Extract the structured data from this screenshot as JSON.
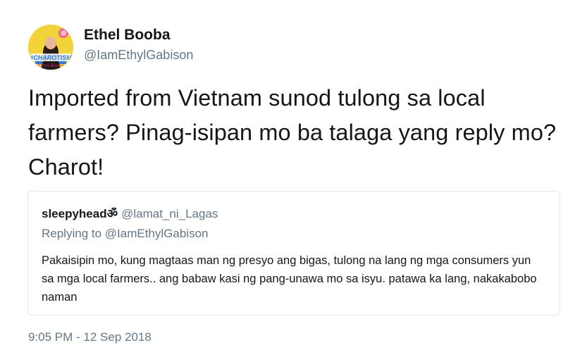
{
  "author": {
    "display_name": "Ethel Booba",
    "handle": "@IamEthylGabison",
    "avatar_text": "#CHAROTISM",
    "avatar_signature": "Ethel Booba",
    "avatar_icon": "profile-avatar"
  },
  "tweet": {
    "text": "Imported from Vietnam sunod tulong sa local farmers? Pinag-isipan mo ba talaga yang reply mo? Charot!",
    "timestamp": "9:05 PM - 12 Sep 2018"
  },
  "quoted_tweet": {
    "display_name": "sleepyheadॐ",
    "handle": "@lamat_ni_Lagas",
    "replying_to": "Replying to @IamEthylGabison",
    "text": "Pakaisipin mo, kung magtaas man ng presyo ang bigas, tulong na lang ng mga consumers yun sa mga local farmers.. ang babaw kasi ng pang-unawa mo sa isyu. patawa ka lang, nakakabobo naman"
  },
  "colors": {
    "primary_text": "#14171a",
    "secondary_text": "#657786",
    "card_border": "#e1e8ed",
    "avatar_bg": "#f2d43a"
  }
}
